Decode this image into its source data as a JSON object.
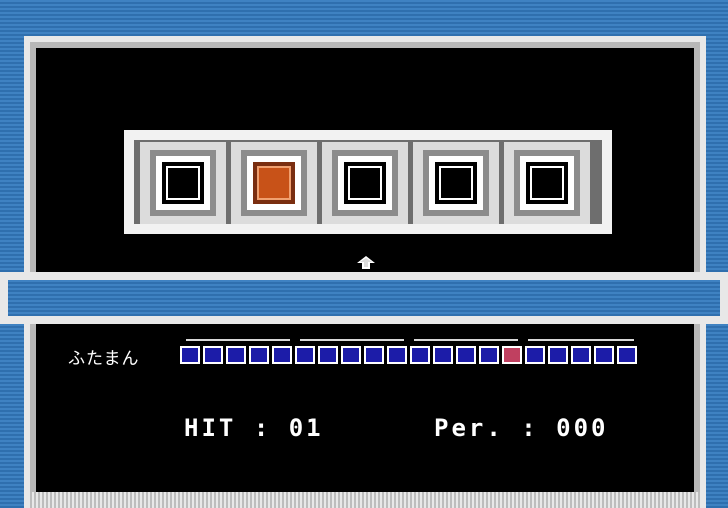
{
  "slots": [
    {
      "state": "empty"
    },
    {
      "state": "lit"
    },
    {
      "state": "empty"
    },
    {
      "state": "empty"
    },
    {
      "state": "empty"
    }
  ],
  "cursor_slot": 2,
  "player": {
    "name": "ふたまん",
    "meter_total": 20,
    "meter_marked_index": 14
  },
  "score": {
    "hit_label": "HIT",
    "hit_value": "01",
    "per_label": "Per.",
    "per_value": "000"
  },
  "colors": {
    "background_blue": "#3a7ab8",
    "frame_gray": "#e8e8e8",
    "lit_slot": "#c85218",
    "meter_blue": "#1c1ca8",
    "meter_marked": "#c04060"
  }
}
